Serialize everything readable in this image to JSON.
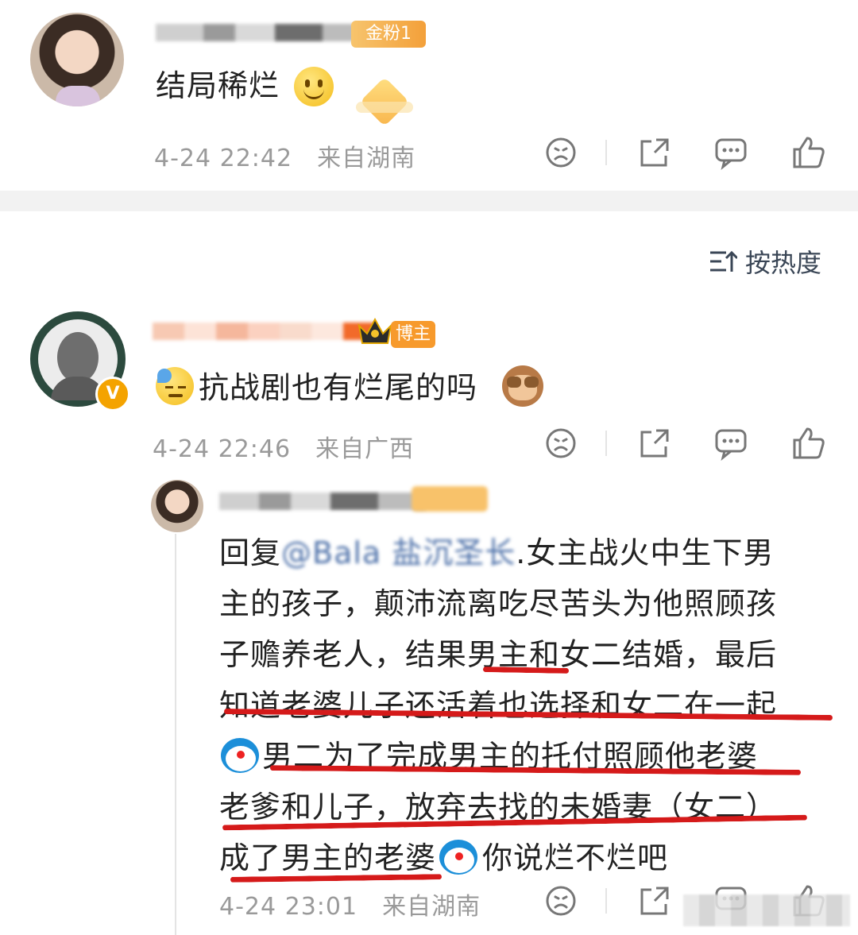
{
  "comments": [
    {
      "text": "结局稀烂",
      "time": "4-24 22:42",
      "location": "来自湖南",
      "badge_label": "金粉1",
      "emoji_icon": "smile-emoji"
    },
    {
      "text": "抗战剧也有烂尾的吗",
      "time": "4-24 22:46",
      "location": "来自广西",
      "badge_label": "博主",
      "leading_emoji": "sweat-emoji",
      "trailing_emoji": "see-no-evil-monkey-emoji"
    }
  ],
  "sort": {
    "label": "按热度"
  },
  "reply": {
    "prefix": "回复",
    "mention": "@Bala 盐沉圣长",
    "lines": [
      ".女主战火中生下男",
      "主的孩子，颠沛流离吃尽苦头为他照顾孩",
      "子赡养老人，结果男主和女二结婚，最后",
      "知道老婆儿子还活着也选择和女二在一起",
      "男二为了完成男主的托付照顾他老婆",
      "老爹和儿子，放弃去找的未婚妻（女二）",
      "成了男主的老婆",
      "你说烂不烂吧"
    ],
    "time": "4-24 23:01",
    "location": "来自湖南"
  },
  "colors": {
    "divider": "#f2f2f2",
    "underline": "#d51a1a",
    "meta": "#9a9a9a"
  }
}
